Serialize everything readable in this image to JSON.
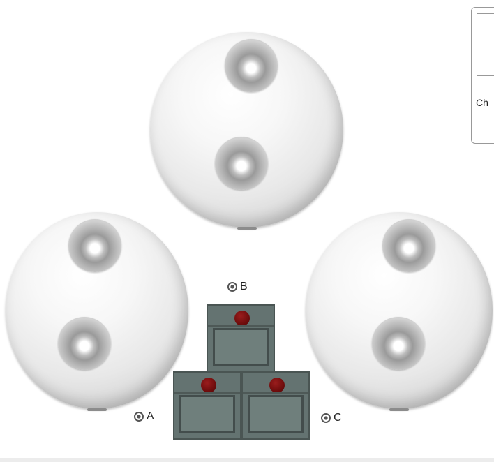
{
  "shelves": {
    "b": {
      "label": "B",
      "icon": "eye-icon"
    },
    "a": {
      "label": "A",
      "icon": "eye-icon"
    },
    "c": {
      "label": "C",
      "icon": "eye-icon"
    }
  },
  "side_panel": {
    "partial_text": "Ch"
  },
  "colors": {
    "shelf_body": "#647371",
    "shelf_border": "#434d4c",
    "knob": "#6f0d0d",
    "ball": "#f2f2f2"
  }
}
